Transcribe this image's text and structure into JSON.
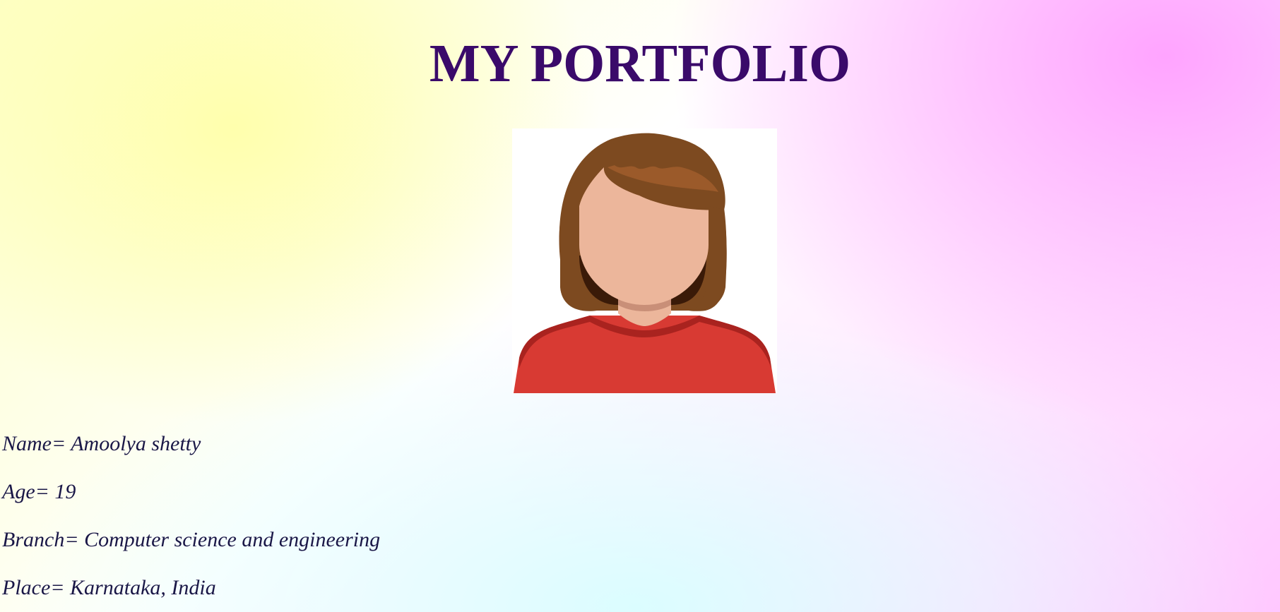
{
  "page": {
    "title": "MY PORTFOLIO"
  },
  "avatar": {
    "icon": "female-avatar-icon"
  },
  "details": [
    {
      "label": "Name=",
      "value": "Amoolya shetty"
    },
    {
      "label": "Age=",
      "value": "19"
    },
    {
      "label": "Branch=",
      "value": "Computer science and engineering"
    },
    {
      "label": "Place=",
      "value": "Karnataka, India"
    }
  ],
  "colors": {
    "title": "#3a0a6a",
    "text": "#1a1747",
    "hair": "#7d4a20",
    "skin": "#ecb69b",
    "shirt": "#d83a33"
  }
}
